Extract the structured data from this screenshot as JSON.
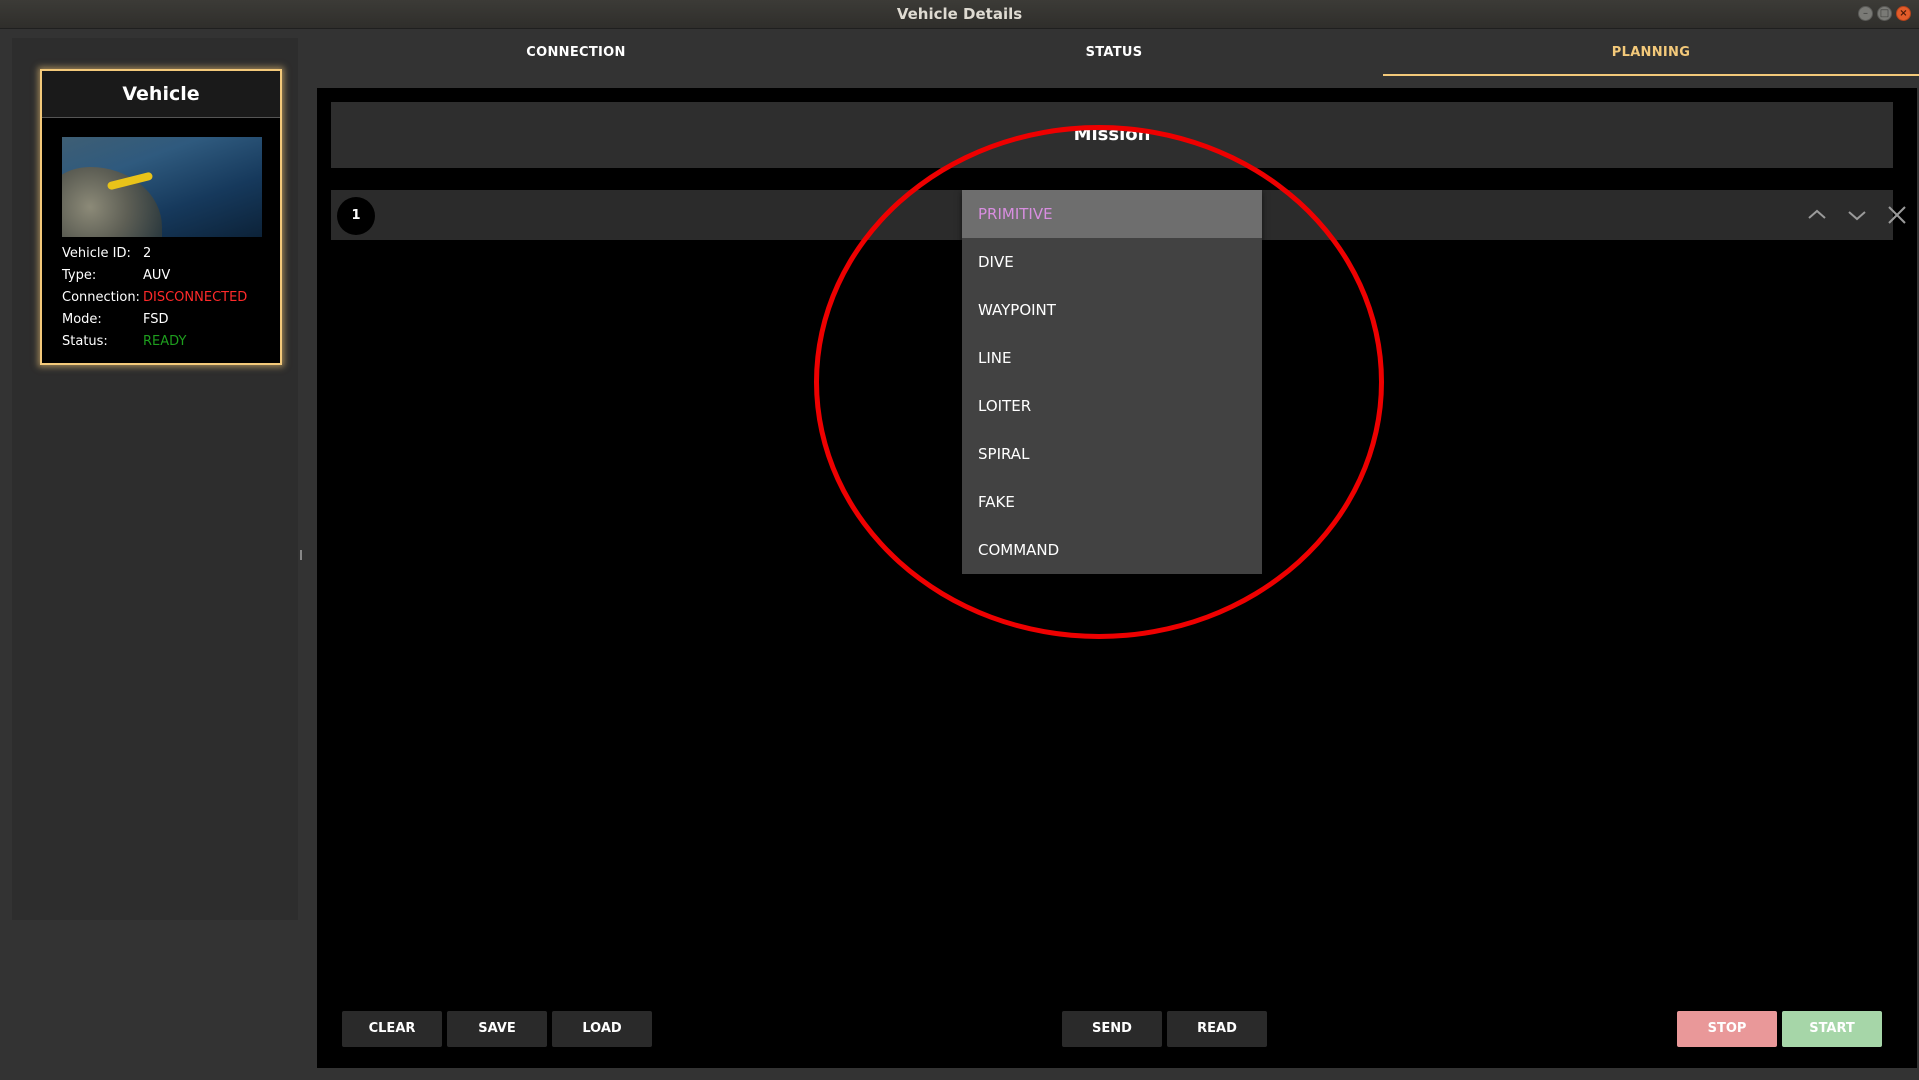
{
  "window": {
    "title": "Vehicle Details",
    "controls": [
      "minimize",
      "maximize",
      "close"
    ]
  },
  "vehicle_card": {
    "title": "Vehicle",
    "image": "auv-underwater-photo",
    "info": [
      {
        "key": "Vehicle ID:",
        "value": "2"
      },
      {
        "key": "Type:",
        "value": "AUV"
      },
      {
        "key": "Connection:",
        "value": "DISCONNECTED",
        "color": "#ff2a2a"
      },
      {
        "key": "Mode:",
        "value": "FSD"
      },
      {
        "key": "Status:",
        "value": "READY",
        "color": "#1e9e1e"
      }
    ]
  },
  "tabs": [
    {
      "label": "CONNECTION",
      "active": false
    },
    {
      "label": "STATUS",
      "active": false
    },
    {
      "label": "PLANNING",
      "active": true
    }
  ],
  "mission": {
    "header": "Mission",
    "steps": [
      {
        "number": "1",
        "type": "PRIMITIVE"
      }
    ]
  },
  "dropdown": {
    "selected": "PRIMITIVE",
    "options": [
      "PRIMITIVE",
      "DIVE",
      "WAYPOINT",
      "LINE",
      "LOITER",
      "SPIRAL",
      "FAKE",
      "COMMAND"
    ]
  },
  "buttons": {
    "clear": "CLEAR",
    "save": "SAVE",
    "load": "LOAD",
    "send": "SEND",
    "read": "READ",
    "stop": "STOP",
    "start": "START"
  },
  "colors": {
    "accent": "#f3c97a",
    "disconnected": "#ff2a2a",
    "ready": "#1e9e1e",
    "selected_option": "#d88ee0",
    "stop_button": "#e99899",
    "start_button": "#a6d6a8",
    "annotation": "#ee0000"
  }
}
